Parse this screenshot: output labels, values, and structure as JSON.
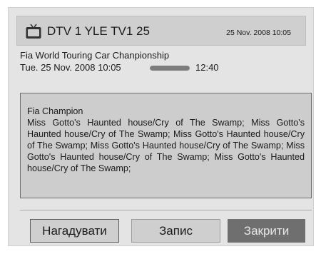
{
  "header": {
    "icon": "tv-icon",
    "channel": "DTV  1 YLE TV1 25",
    "datetime": "25 Nov. 2008 10:05"
  },
  "program": {
    "title": "Fia World Touring Car Chanpionship",
    "start": "Tue. 25 Nov. 2008 10:05",
    "end": "12:40",
    "progress": 1.0
  },
  "description": {
    "heading": "Fia Champion",
    "text": "Miss Gotto's Haunted house/Cry of The Swamp; Miss Gotto's Haunted house/Cry of The Swamp; Miss Gotto's Haunted house/Cry of The Swamp; Miss Gotto's Haunted house/Cry of The Swamp; Miss Gotto's Haunted house/Cry of The Swamp; Miss Gotto's Haunted house/Cry of The Swamp;"
  },
  "buttons": {
    "remind": "Нагадувати",
    "record": "Запис",
    "close": "Закрити"
  },
  "colors": {
    "panel": "#e4e4e4",
    "header": "#cfcfcf",
    "close_button": "#6f6f6f"
  }
}
